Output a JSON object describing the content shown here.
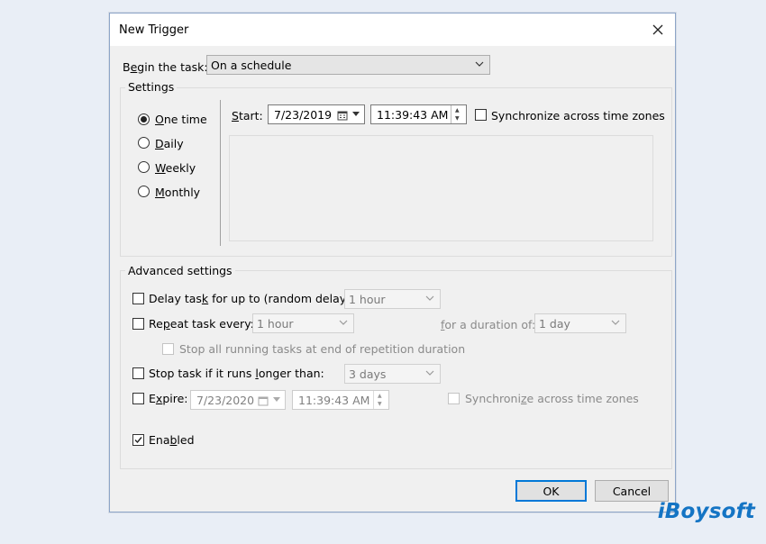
{
  "dialog": {
    "title": "New Trigger",
    "begin_task": {
      "label_pre": "B",
      "label_u": "e",
      "label_post": "gin the task:",
      "value": "On a schedule"
    },
    "settings": {
      "legend": "Settings",
      "radios": [
        {
          "u": "O",
          "rest": "ne time",
          "selected": true
        },
        {
          "u": "D",
          "rest": "aily",
          "selected": false
        },
        {
          "u": "W",
          "rest": "eekly",
          "selected": false
        },
        {
          "u": "M",
          "rest": "onthly",
          "selected": false
        }
      ],
      "start_label_u": "S",
      "start_label_rest": "tart:",
      "start_date": "7/23/2019",
      "start_time": "11:39:43 AM",
      "sync_label": "Synchronize across time zones"
    },
    "advanced": {
      "legend": "Advanced settings",
      "delay": {
        "pre": "Delay tas",
        "u": "k",
        "post": " for up to (random delay):",
        "value": "1 hour"
      },
      "repeat": {
        "pre": "Re",
        "u": "p",
        "post": "eat task every:",
        "value": "1 hour",
        "duration_pre": "",
        "duration_u": "f",
        "duration_post": "or a duration of:",
        "duration_value": "1 day"
      },
      "stop_all": "Stop all running tasks at end of repetition duration",
      "stop_if": {
        "pre": "Stop task if it runs ",
        "u": "l",
        "post": "onger than:",
        "value": "3 days"
      },
      "expire": {
        "pre": "E",
        "u": "x",
        "post": "pire:",
        "date": "7/23/2020",
        "time": "11:39:43 AM",
        "sync_pre": "Synchroni",
        "sync_u": "z",
        "sync_post": "e across time zones"
      },
      "enabled": {
        "pre": "Ena",
        "u": "b",
        "post": "led"
      }
    },
    "buttons": {
      "ok": "OK",
      "cancel": "Cancel"
    }
  },
  "watermark": "iBoysoft",
  "colors": {
    "accent": "#0078d7",
    "watermark": "#1474c4"
  },
  "icons": [
    "close-icon",
    "chevron-down-icon",
    "calendar-icon",
    "spin-up-icon",
    "spin-down-icon",
    "checkmark-icon"
  ]
}
